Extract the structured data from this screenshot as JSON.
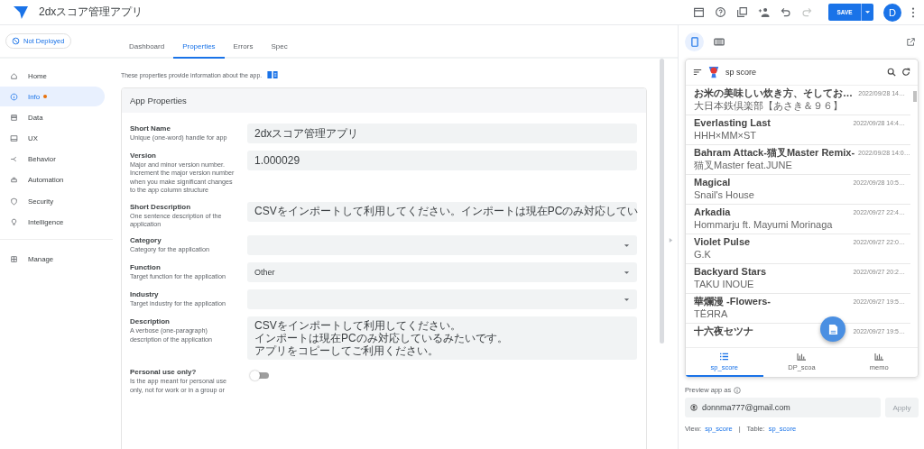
{
  "header": {
    "title": "2dxスコア管理アプリ",
    "save": "SAVE",
    "avatar": "D"
  },
  "deploy_status": "Not Deployed",
  "tabs": [
    {
      "label": "Dashboard",
      "selected": false
    },
    {
      "label": "Properties",
      "selected": true
    },
    {
      "label": "Errors",
      "selected": false
    },
    {
      "label": "Spec",
      "selected": false
    }
  ],
  "sidebar": {
    "items": [
      {
        "label": "Home",
        "selected": false,
        "alert": false
      },
      {
        "label": "Info",
        "selected": true,
        "alert": true
      },
      {
        "label": "Data",
        "selected": false,
        "alert": false
      },
      {
        "label": "UX",
        "selected": false,
        "alert": false
      },
      {
        "label": "Behavior",
        "selected": false,
        "alert": false
      },
      {
        "label": "Automation",
        "selected": false,
        "alert": false
      },
      {
        "label": "Security",
        "selected": false,
        "alert": false
      },
      {
        "label": "Intelligence",
        "selected": false,
        "alert": false
      }
    ],
    "footer_items": [
      {
        "label": "Manage",
        "selected": false,
        "alert": false
      }
    ]
  },
  "intro": "These properties provide information about the app.",
  "card": {
    "title": "App Properties",
    "fields": [
      {
        "kind": "text",
        "label": "Short Name",
        "hint": "Unique (one-word) handle for app",
        "value": "2dxスコア管理アプリ"
      },
      {
        "kind": "text",
        "label": "Version",
        "hint": "Major and minor version number. Increment the major version number when you make significant changes to the app column structure",
        "value": "1.000029"
      },
      {
        "kind": "text",
        "label": "Short Description",
        "hint": "One sentence description of the application",
        "value": "CSVをインポートして利用してください。インポートは現在PCのみ対応してい"
      },
      {
        "kind": "select",
        "label": "Category",
        "hint": "Category for the application"
      },
      {
        "kind": "select",
        "label": "Function",
        "hint": "Target function for the application",
        "value": "Other"
      },
      {
        "kind": "select",
        "label": "Industry",
        "hint": "Target industry for the application"
      },
      {
        "kind": "textarea",
        "label": "Description",
        "hint": "A verbose (one-paragraph) description of the application",
        "lines": [
          "CSVをインポートして利用してください。",
          "インポートは現在PCのみ対応しているみたいです。",
          "アプリをコピーしてご利用ください。"
        ]
      },
      {
        "kind": "toggle",
        "label": "Personal use only?",
        "hint": "Is the app meant for personal use only, not for work or in a group or",
        "on": false
      }
    ]
  },
  "preview": {
    "devices": [
      {
        "selected": true
      },
      {
        "selected": false
      }
    ],
    "app": {
      "title": "sp score",
      "rows": [
        {
          "title": "お米の美味しい炊き方、そしてお…",
          "date": "2022/09/28 14…",
          "subtitle": "大日本鉄倶楽部【あさき＆９６】"
        },
        {
          "title": "Everlasting Last",
          "date": "2022/09/28 14:4…",
          "subtitle": "HHH×MM×ST"
        },
        {
          "title": "Bahram Attack-猫叉Master Remix-",
          "date": "2022/09/28 14:0…",
          "subtitle": "猫叉Master feat.JUNE"
        },
        {
          "title": "Magical",
          "date": "2022/09/28 10:5…",
          "subtitle": "Snail's House"
        },
        {
          "title": "Arkadia",
          "date": "2022/09/27 22:4…",
          "subtitle": "Hommarju ft. Mayumi Morinaga"
        },
        {
          "title": "Violet Pulse",
          "date": "2022/09/27 22:0…",
          "subtitle": "G.K"
        },
        {
          "title": "Backyard Stars",
          "date": "2022/09/27 20:2…",
          "subtitle": "TAKU INOUE"
        },
        {
          "title": "華爛漫 -Flowers-",
          "date": "2022/09/27 19:5…",
          "subtitle": "TЁЯRA"
        },
        {
          "title": "十六夜セツナ",
          "date": "2022/09/27 19:5…"
        }
      ],
      "nav": [
        {
          "label": "sp_score",
          "selected": true
        },
        {
          "label": "DP_scoa",
          "selected": false
        },
        {
          "label": "memo",
          "selected": false
        }
      ]
    },
    "preview_as": "Preview app as",
    "user": "donnma777@gmail.com",
    "apply": "Apply",
    "footer": [
      {
        "kind": "label",
        "text": "View:"
      },
      {
        "kind": "link",
        "text": "sp_score"
      },
      {
        "kind": "separator",
        "text": "|"
      },
      {
        "kind": "label",
        "text": "Table:"
      },
      {
        "kind": "link",
        "text": "sp_score"
      }
    ]
  }
}
